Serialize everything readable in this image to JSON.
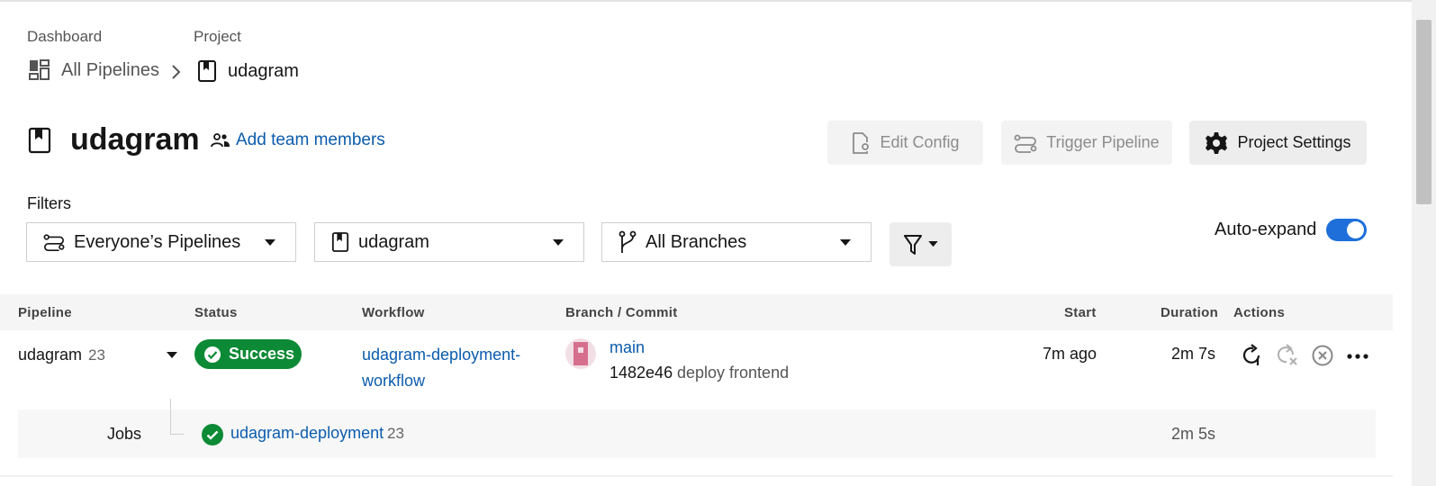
{
  "breadcrumb": {
    "dashboard_title": "Dashboard",
    "dashboard_link": "All Pipelines",
    "project_title": "Project",
    "project_link": "udagram"
  },
  "header": {
    "project_name": "udagram",
    "add_team_label": "Add team members",
    "edit_config_label": "Edit Config",
    "trigger_pipeline_label": "Trigger Pipeline",
    "project_settings_label": "Project Settings"
  },
  "filters": {
    "label": "Filters",
    "pipelines_select": "Everyone’s Pipelines",
    "project_select": "udagram",
    "branches_select": "All Branches",
    "auto_expand_label": "Auto-expand",
    "auto_expand_on": true
  },
  "table": {
    "columns": [
      "Pipeline",
      "Status",
      "Workflow",
      "Branch / Commit",
      "Start",
      "Duration",
      "Actions"
    ],
    "rows": [
      {
        "pipeline": "udagram",
        "number": "23",
        "status": "Success",
        "workflow": "udagram-deployment-workflow",
        "branch": "main",
        "commit_hash": "1482e46",
        "commit_message": "deploy frontend",
        "start": "7m ago",
        "duration": "2m 7s",
        "jobs_label": "Jobs",
        "job": {
          "name": "udagram-deployment",
          "number": "23",
          "duration": "2m 5s"
        }
      }
    ]
  },
  "colors": {
    "link": "#0b5cad",
    "success": "#0c8a35",
    "toggle": "#1e6fd9"
  },
  "icons": {
    "dashboard": "dashboard-icon",
    "project": "bookmark-icon",
    "team": "people-icon",
    "edit_config": "file-gear-icon",
    "trigger": "pipeline-icon",
    "settings": "gear-icon",
    "branch": "git-branch-icon",
    "filter": "funnel-icon",
    "rerun": "rerun-icon",
    "rerun_failed": "rerun-failed-icon",
    "cancel": "cancel-icon",
    "more": "more-icon"
  }
}
